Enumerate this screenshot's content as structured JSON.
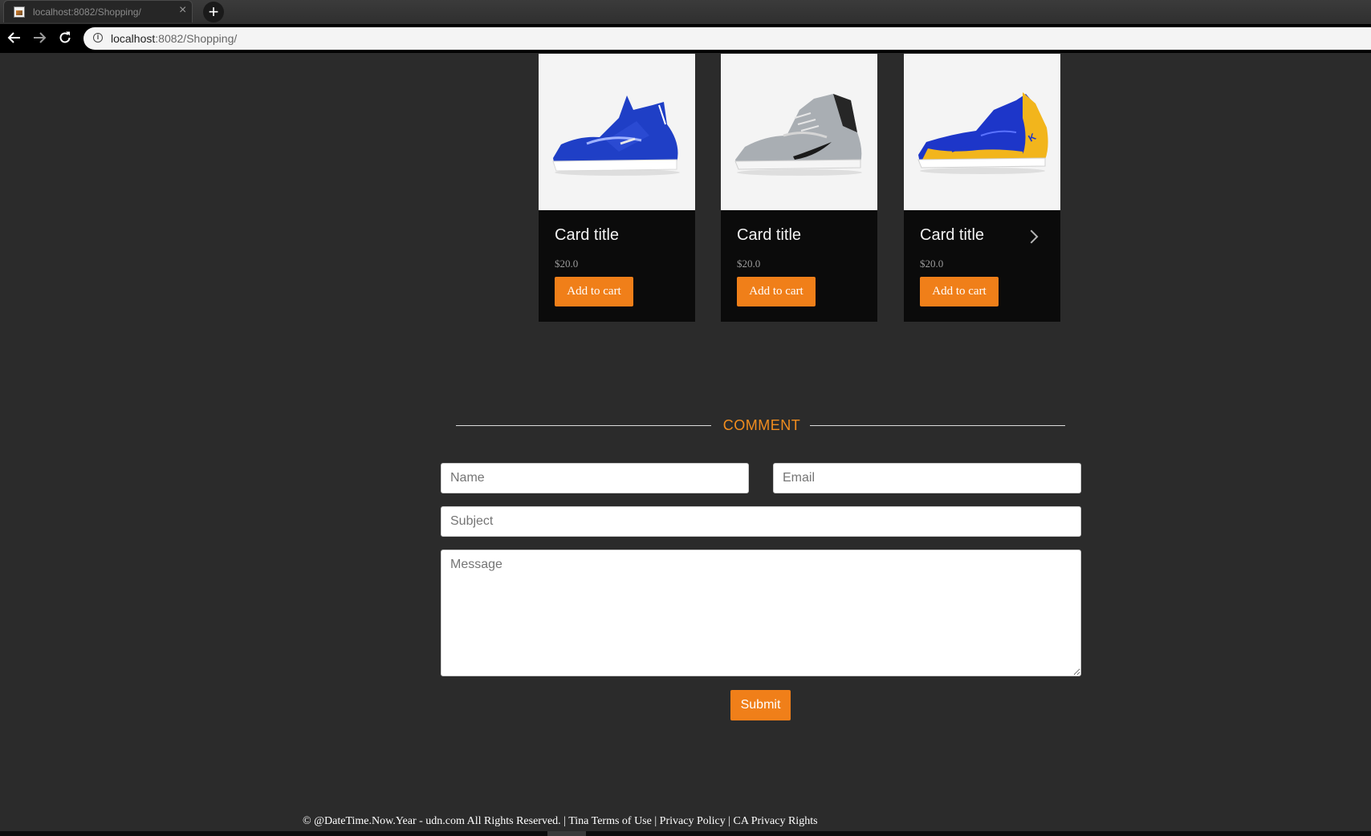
{
  "browser": {
    "tab_title": "localhost:8082/Shopping/",
    "tab_close": "×",
    "new_tab": "+",
    "url_host": "localhost",
    "url_rest": ":8082/Shopping/",
    "info": "i"
  },
  "products": [
    {
      "title": "Card title",
      "price": "$20.0",
      "button": "Add to cart",
      "image": "blue-basketball-shoe",
      "colors": {
        "main": "#1f3fc6",
        "accent": "#ffffff"
      }
    },
    {
      "title": "Card title",
      "price": "$20.0",
      "button": "Add to cart",
      "image": "grey-basketball-shoe",
      "colors": {
        "main": "#a9aeb3",
        "accent": "#1a1a1a"
      }
    },
    {
      "title": "Card title",
      "price": "$20.0",
      "button": "Add to cart",
      "image": "blue-gold-basketball-shoe",
      "colors": {
        "main": "#1d36c9",
        "accent": "#f2b51c"
      }
    }
  ],
  "comment": {
    "title": "COMMENT",
    "name_placeholder": "Name",
    "email_placeholder": "Email",
    "subject_placeholder": "Subject",
    "message_placeholder": "Message",
    "submit_label": "Submit"
  },
  "footer": {
    "copyright": "© @DateTime.Now.Year - udn.com All Rights Reserved. | Tina ",
    "terms": "Terms of Use",
    "sep1": " | ",
    "privacy": "Privacy Policy",
    "sep2": " | ",
    "ca_privacy": "CA Privacy Rights"
  },
  "theme": {
    "background": "#2b2b2b",
    "accent": "#f07f19",
    "card_background": "#0b0b0b"
  }
}
